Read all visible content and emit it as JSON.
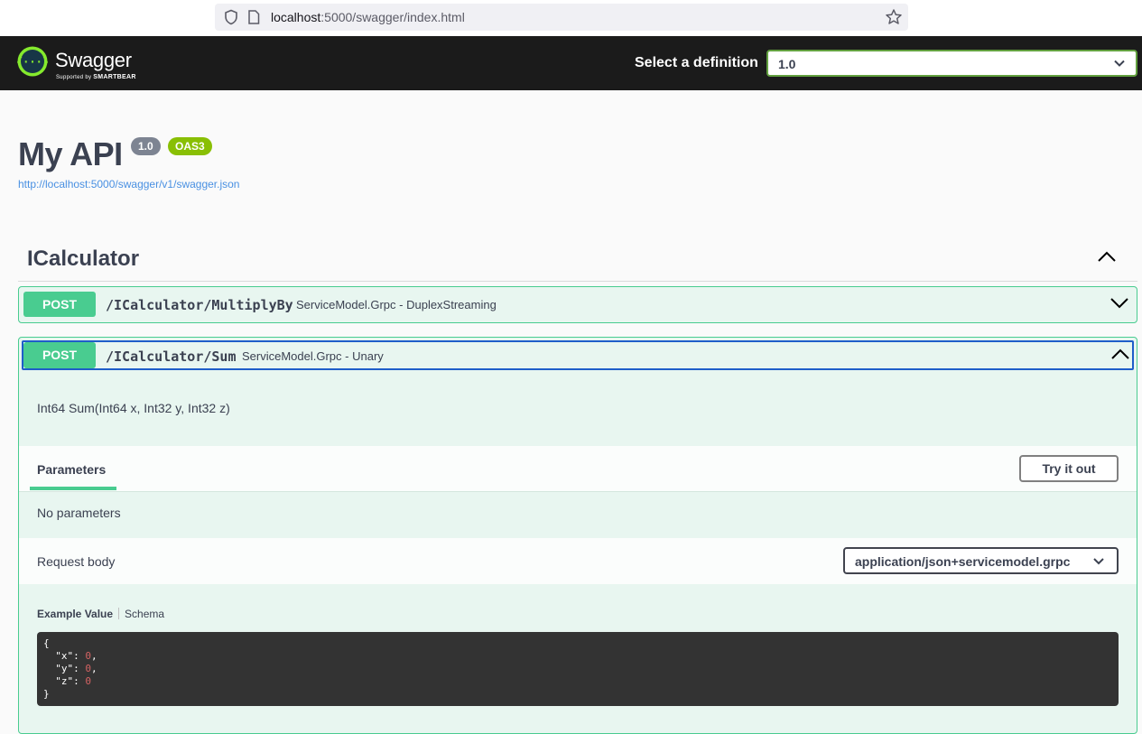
{
  "browser": {
    "url_host": "localhost",
    "url_rest": ":5000/swagger/index.html"
  },
  "topbar": {
    "logo_text": "Swagger",
    "logo_sub_prefix": "Supported by",
    "logo_sub_brand": "SMARTBEAR",
    "definition_label": "Select a definition",
    "definition_value": "1.0"
  },
  "info": {
    "title": "My API",
    "version": "1.0",
    "oas_badge": "OAS3",
    "spec_url": "http://localhost:5000/swagger/v1/swagger.json"
  },
  "tag": {
    "name": "ICalculator"
  },
  "operations": [
    {
      "method": "POST",
      "path": "/ICalculator/MultiplyBy",
      "summary": "ServiceModel.Grpc - DuplexStreaming",
      "expanded": false
    },
    {
      "method": "POST",
      "path": "/ICalculator/Sum",
      "summary": "ServiceModel.Grpc - Unary",
      "expanded": true,
      "description": "Int64 Sum(Int64 x, Int32 y, Int32 z)",
      "parameters_tab": "Parameters",
      "try_button": "Try it out",
      "no_parameters": "No parameters",
      "request_body_label": "Request body",
      "content_type": "application/json+servicemodel.grpc",
      "example_value_tab": "Example Value",
      "schema_tab": "Schema",
      "example": {
        "open": "{",
        "keys": [
          "\"x\"",
          "\"y\"",
          "\"z\""
        ],
        "values": [
          "0",
          "0",
          "0"
        ],
        "close": "}"
      }
    }
  ],
  "colors": {
    "post": "#49cc90",
    "post_bg": "#e8f6f0",
    "topbar": "#1b1b1b",
    "link": "#4990e2",
    "focus": "#1f5ec9"
  }
}
